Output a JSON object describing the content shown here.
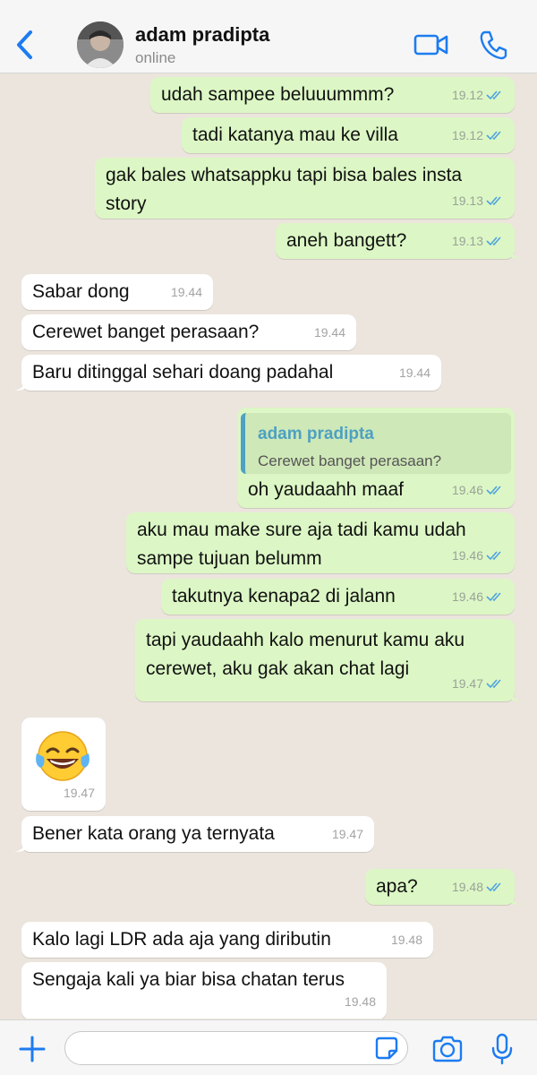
{
  "header": {
    "back_icon": "chevron-left-icon",
    "contact_name": "adam pradipta",
    "status": "online",
    "video_icon": "video-camera-icon",
    "call_icon": "phone-icon",
    "accent_color": "#1C7CF0"
  },
  "messages": [
    {
      "dir": "out",
      "text": "udah sampee beluuummm?",
      "time": "19.12",
      "ticks": "read"
    },
    {
      "dir": "out",
      "text": "tadi katanya mau ke villa",
      "time": "19.12",
      "ticks": "read"
    },
    {
      "dir": "out",
      "text": "gak bales whatsappku tapi bisa bales insta\nstory",
      "time": "19.13",
      "ticks": "read"
    },
    {
      "dir": "out",
      "text": "aneh bangett?",
      "time": "19.13",
      "ticks": "read"
    },
    {
      "dir": "in",
      "text": "Sabar dong",
      "time": "19.44"
    },
    {
      "dir": "in",
      "text": "Cerewet banget perasaan?",
      "time": "19.44"
    },
    {
      "dir": "in",
      "text": "Baru ditinggal sehari doang padahal",
      "time": "19.44"
    },
    {
      "dir": "out",
      "quote": {
        "name": "adam pradipta",
        "text": "Cerewet banget perasaan?"
      },
      "text": "oh yaudaahh maaf",
      "time": "19.46",
      "ticks": "read"
    },
    {
      "dir": "out",
      "text": "aku mau make sure aja tadi kamu udah\nsampe tujuan belumm",
      "time": "19.46",
      "ticks": "read"
    },
    {
      "dir": "out",
      "text": "takutnya kenapa2 di jalann",
      "time": "19.46",
      "ticks": "read"
    },
    {
      "dir": "out",
      "text": "tapi yaudaahh kalo menurut kamu aku\ncerewet, aku gak akan chat lagi",
      "time": "19.47",
      "ticks": "read"
    },
    {
      "dir": "in",
      "emoji": "face-with-tears-of-joy-emoji",
      "time": "19.47"
    },
    {
      "dir": "in",
      "text": "Bener kata orang ya ternyata",
      "time": "19.47"
    },
    {
      "dir": "out",
      "text": "apa?",
      "time": "19.48",
      "ticks": "read"
    },
    {
      "dir": "in",
      "text": "Kalo lagi LDR ada aja yang diributin",
      "time": "19.48"
    },
    {
      "dir": "in",
      "text": "Sengaja kali ya biar bisa chatan terus",
      "time": "19.48"
    }
  ],
  "input": {
    "placeholder": "",
    "plus_icon": "plus-icon",
    "sticker_icon": "sticker-icon",
    "camera_icon": "camera-icon",
    "mic_icon": "microphone-icon"
  },
  "colors": {
    "outgoing_bubble": "#DCF7C5",
    "incoming_bubble": "#FFFFFF",
    "chat_background": "#ECE5DD",
    "read_ticks": "#4FA3E0"
  }
}
